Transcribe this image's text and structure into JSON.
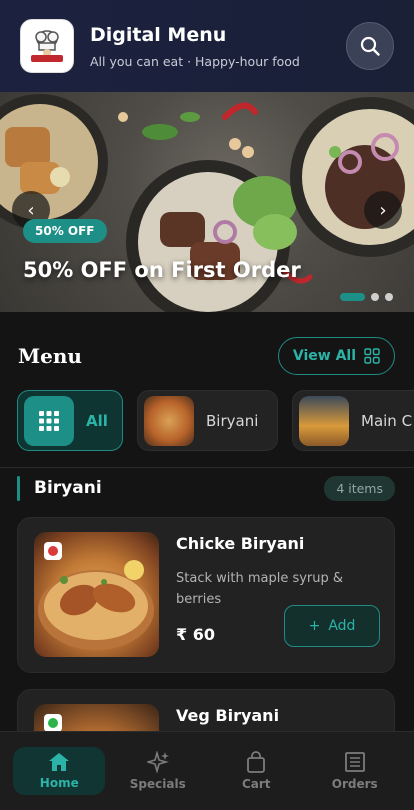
{
  "header": {
    "title": "Digital Menu",
    "subtitle": "All you can eat · Happy-hour food",
    "logo_icon": "restaurant-logo",
    "search_icon": "search-icon"
  },
  "banner": {
    "badge": "50% OFF",
    "title": "50% OFF on First Order",
    "prev_icon": "chevron-left-icon",
    "next_icon": "chevron-right-icon",
    "slide_count": 3,
    "active_slide": 1
  },
  "menu": {
    "title": "Menu",
    "view_all_label": "View All"
  },
  "categories": [
    {
      "label": "All",
      "icon": "grid-icon",
      "active": true
    },
    {
      "label": "Biryani",
      "icon": "biryani-thumbnail",
      "active": false
    },
    {
      "label": "Main C",
      "icon": "pancakes-thumbnail",
      "active": false
    }
  ],
  "section": {
    "title": "Biryani",
    "count_label": "4 items"
  },
  "items": [
    {
      "name": "Chicke Biryani",
      "description": "Stack with maple syrup & berries",
      "price": "₹ 60",
      "add_label": "Add",
      "veg": false,
      "veg_color": "#d93a3a"
    },
    {
      "name": "Veg Biryani",
      "veg": true,
      "veg_color": "#2db34a"
    }
  ],
  "bottom_nav": [
    {
      "label": "Home",
      "icon": "home-icon",
      "active": true
    },
    {
      "label": "Specials",
      "icon": "sparkle-icon",
      "active": false
    },
    {
      "label": "Cart",
      "icon": "shopping-bag-icon",
      "active": false
    },
    {
      "label": "Orders",
      "icon": "receipt-icon",
      "active": false
    }
  ],
  "colors": {
    "accent": "#1d8f86",
    "accent_text": "#2bb3a7",
    "header_bg": "#1c2140",
    "background": "#141414"
  }
}
